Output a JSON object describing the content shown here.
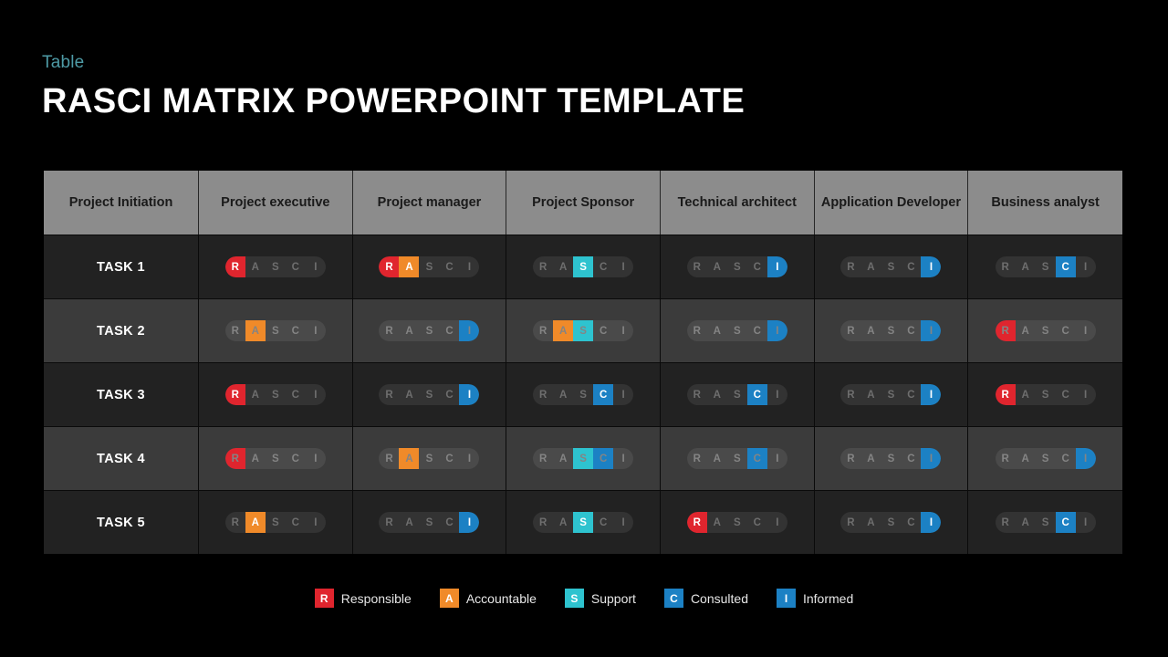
{
  "slide": {
    "eyebrow": "Table",
    "title": "RASCI MATRIX POWERPOINT TEMPLATE"
  },
  "colors": {
    "responsible": "#e0252e",
    "accountable": "#f08a29",
    "support": "#2ec3cf",
    "consulted": "#1c81c4",
    "informed": "#1c81c4",
    "eyebrow": "#4e9ba6",
    "header_bg": "#8c8c8c",
    "row_odd_bg": "#222222",
    "row_even_bg": "#3b3b3b",
    "slide_bg": "#000000"
  },
  "table": {
    "columns": [
      "Project Initiation",
      "Project executive",
      "Project manager",
      "Project Sponsor",
      "Technical architect",
      "Application Developer",
      "Business analyst"
    ],
    "letters": [
      "R",
      "A",
      "S",
      "C",
      "I"
    ],
    "rows": [
      {
        "task": "TASK 1",
        "assignments": [
          [
            "R"
          ],
          [
            "R",
            "A"
          ],
          [
            "S"
          ],
          [
            "I"
          ],
          [
            "I"
          ],
          [
            "C"
          ]
        ]
      },
      {
        "task": "TASK 2",
        "assignments": [
          [
            "A"
          ],
          [
            "I"
          ],
          [
            "A",
            "S"
          ],
          [
            "I"
          ],
          [
            "I"
          ],
          [
            "R"
          ]
        ]
      },
      {
        "task": "TASK 3",
        "assignments": [
          [
            "R"
          ],
          [
            "I"
          ],
          [
            "C"
          ],
          [
            "C"
          ],
          [
            "I"
          ],
          [
            "R"
          ]
        ]
      },
      {
        "task": "TASK 4",
        "assignments": [
          [
            "R"
          ],
          [
            "A"
          ],
          [
            "S",
            "C"
          ],
          [
            "C"
          ],
          [
            "I"
          ],
          [
            "I"
          ]
        ]
      },
      {
        "task": "TASK 5",
        "assignments": [
          [
            "A"
          ],
          [
            "I"
          ],
          [
            "S"
          ],
          [
            "R"
          ],
          [
            "I"
          ],
          [
            "C"
          ]
        ]
      }
    ]
  },
  "legend": [
    {
      "letter": "R",
      "label": "Responsible",
      "color": "#e0252e"
    },
    {
      "letter": "A",
      "label": "Accountable",
      "color": "#f08a29"
    },
    {
      "letter": "S",
      "label": "Support",
      "color": "#2ec3cf"
    },
    {
      "letter": "C",
      "label": "Consulted",
      "color": "#1c81c4"
    },
    {
      "letter": "I",
      "label": "Informed",
      "color": "#1c81c4"
    }
  ]
}
